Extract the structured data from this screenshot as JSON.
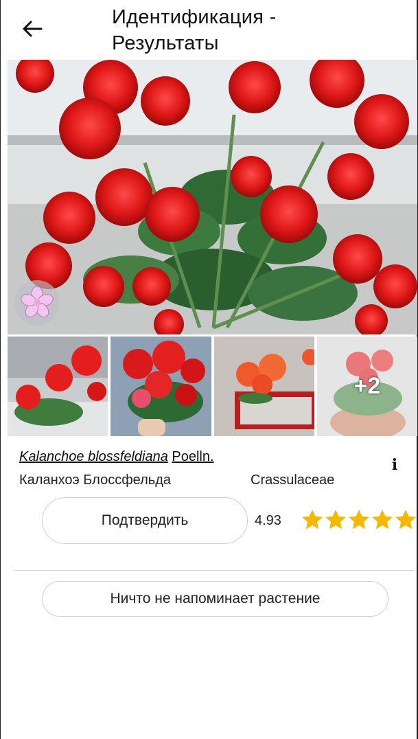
{
  "header": {
    "title_line1": "Идентификация -",
    "title_line2": "Результаты",
    "back_icon": "arrow-left-icon"
  },
  "gallery": {
    "more_count_label": "+2"
  },
  "result": {
    "scientific_name": "Kalanchoe blossfeldiana",
    "author": "Poelln.",
    "common_name": "Каланхоэ Блоссфельда",
    "family": "Crassulaceae",
    "score": "4.93",
    "stars_filled": 5,
    "stars_total": 5,
    "star_color": "#f5b800",
    "info_label": "i"
  },
  "actions": {
    "confirm_label": "Подтвердить",
    "not_plant_label": "Ничто не напоминает растение"
  }
}
